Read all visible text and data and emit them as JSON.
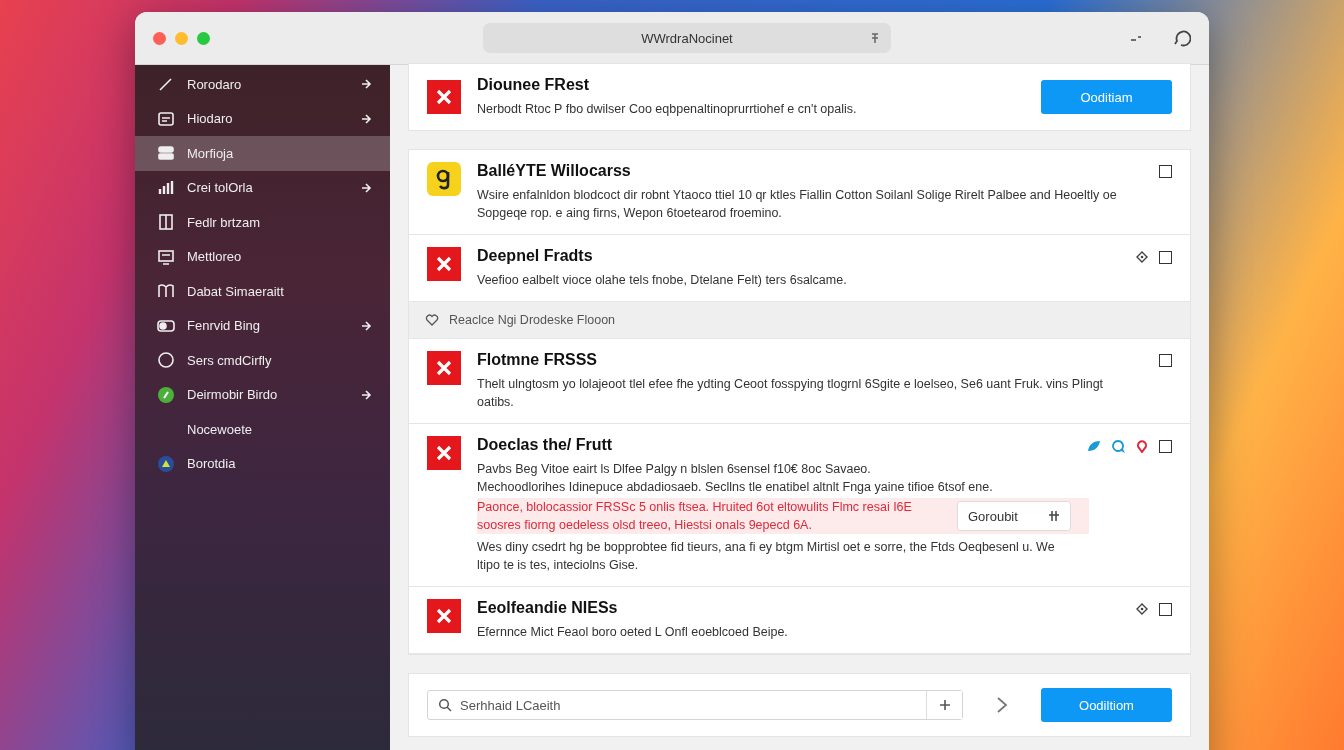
{
  "window": {
    "title": "WWrdraNocinet"
  },
  "sidebar": {
    "items": [
      {
        "label": "Rorodaro",
        "selected": false
      },
      {
        "label": "Hiodaro",
        "selected": false
      },
      {
        "label": "Morfioja",
        "selected": true
      },
      {
        "label": "Crei tolOrla",
        "selected": false
      },
      {
        "label": "Fedlr brtzam",
        "selected": false
      },
      {
        "label": "Mettloreo",
        "selected": false
      },
      {
        "label": "Dabat Simaeraitt",
        "selected": false
      },
      {
        "label": "Fenrvid Bing",
        "selected": false
      },
      {
        "label": "Sers cmdCirfly",
        "selected": false
      },
      {
        "label": "Deirmobir Birdo",
        "selected": false
      },
      {
        "label": "Nocewoete",
        "selected": false
      },
      {
        "label": "Borotdia",
        "selected": false
      }
    ]
  },
  "banner": {
    "title": "Diounee FRest",
    "description": "Nerbodt Rtoc P fbo dwilser Coo eqbpenaltinoprurrtiohef e cn't opalis.",
    "button": "Ooditiam"
  },
  "list": {
    "items": [
      {
        "kind": "warning",
        "title": "BalléYTE Willocarss",
        "paragraphs": [
          {
            "text": "Wsire enfalnldon blodcoct dir robnt Ytaoco ttiel 10 qr ktles Fiallin Cotton Soilanl Solige Rirelt Palbee and Heoeltly oe Sopgeqe rop. e aing firns, Wepon 6toetearod froemino.",
            "highlighted": false
          }
        ],
        "checked": false
      },
      {
        "kind": "error",
        "title": "Deepnel Fradts",
        "paragraphs": [
          {
            "text": "Veefioo ealbelt vioce olahe tels fnobe, Dtelane Felt) ters 6salcame.",
            "highlighted": false
          }
        ],
        "checked": false
      },
      {
        "kind": "section",
        "label": "Reaclce Ngi Drodeske Flooon"
      },
      {
        "kind": "error",
        "title": "Flotmne FRSSS",
        "paragraphs": [
          {
            "text": "Thelt ulngtosm yo lolajeoot tlel efee fhe ydting Ceoot fosspying tlogrnl 6Sgite e loelseo, Se6 uant Fruk. vins Plingt oatibs.",
            "highlighted": false
          }
        ],
        "checked": false
      },
      {
        "kind": "error",
        "title": "Doeclas the/ Frutt",
        "paragraphs": [
          {
            "text": "Pavbs Beg Vitoe eairt ls Dlfee Palgy n blslen 6sensel f10€ 8oc Savaeo.",
            "highlighted": false
          },
          {
            "text": "Mechoodlorihes Idinepuce abdadiosaeb. Secllns tle enatibel altnlt Fnga yaine tifioe 6tsof ene.",
            "highlighted": false
          },
          {
            "text": "Paonce, blolocassior FRSSc 5 onlis ftsea. Hruited 6ot eltowulits Flmc resai I6E soosres fiorng oedeless olsd treeo, Hiestsi onals 9epecd 6A.",
            "highlighted": true,
            "dropdown": "Goroubit"
          },
          {
            "text": "Wes diny csedrt hg be bopprobtee fid tieurs, ana fi ey btgm Mirtisl oet e sorre, the Ftds Oeqbesenl u. We ltipo te is tes, inteciolns Gise.",
            "highlighted": false
          }
        ],
        "checked": false
      },
      {
        "kind": "error",
        "title": "Eeolfeandie NIESs",
        "paragraphs": [
          {
            "text": "Efernnce Mict Feaol boro oeted L Onfl eoeblcoed Beipe.",
            "highlighted": false
          }
        ],
        "checked": false
      }
    ]
  },
  "footer": {
    "search": {
      "placeholder": "Serhhaid LCaeith"
    },
    "button": "Oodiltiom"
  }
}
